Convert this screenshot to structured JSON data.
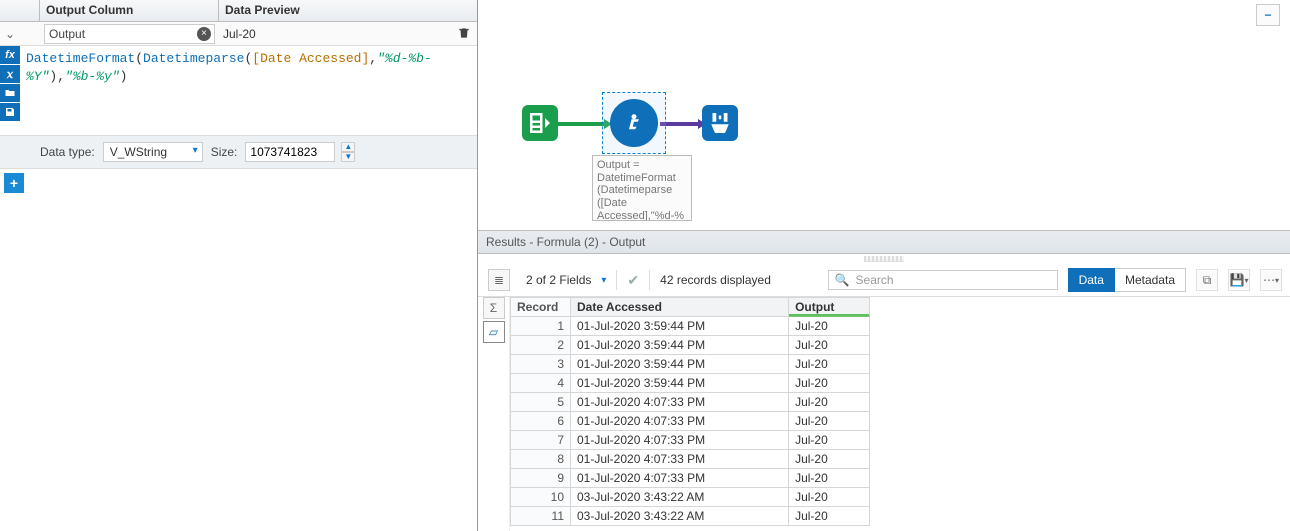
{
  "left": {
    "header_output_col": "Output Column",
    "header_preview": "Data Preview",
    "output_field_value": "Output",
    "preview_value": "Jul-20",
    "formula_fn": "DatetimeFormat",
    "formula_inner_fn": "Datetimeparse",
    "formula_bracket": "[Date Accessed]",
    "formula_lit1": "\"%d-%b-%Y\"",
    "formula_lit2": "\"%b-%y\"",
    "datatype_label": "Data type:",
    "datatype_value": "V_WString",
    "size_label": "Size:",
    "size_value": "1073741823"
  },
  "canvas": {
    "minus": "−",
    "anno_line1": "Output =",
    "anno_line2": "DatetimeFormat",
    "anno_line3": "(Datetimeparse",
    "anno_line4": "([Date",
    "anno_line5": "Accessed],\"%d-%"
  },
  "results": {
    "title": "Results - Formula (2) - Output",
    "fields_text": "2 of 2 Fields",
    "records_text": "42 records displayed",
    "search_placeholder": "Search",
    "data_label": "Data",
    "metadata_label": "Metadata",
    "columns": {
      "record": "Record",
      "date": "Date Accessed",
      "output": "Output"
    },
    "rows": [
      {
        "n": 1,
        "date": "01-Jul-2020 3:59:44 PM",
        "out": "Jul-20"
      },
      {
        "n": 2,
        "date": "01-Jul-2020 3:59:44 PM",
        "out": "Jul-20"
      },
      {
        "n": 3,
        "date": "01-Jul-2020 3:59:44 PM",
        "out": "Jul-20"
      },
      {
        "n": 4,
        "date": "01-Jul-2020 3:59:44 PM",
        "out": "Jul-20"
      },
      {
        "n": 5,
        "date": "01-Jul-2020 4:07:33 PM",
        "out": "Jul-20"
      },
      {
        "n": 6,
        "date": "01-Jul-2020 4:07:33 PM",
        "out": "Jul-20"
      },
      {
        "n": 7,
        "date": "01-Jul-2020 4:07:33 PM",
        "out": "Jul-20"
      },
      {
        "n": 8,
        "date": "01-Jul-2020 4:07:33 PM",
        "out": "Jul-20"
      },
      {
        "n": 9,
        "date": "01-Jul-2020 4:07:33 PM",
        "out": "Jul-20"
      },
      {
        "n": 10,
        "date": "03-Jul-2020 3:43:22 AM",
        "out": "Jul-20"
      },
      {
        "n": 11,
        "date": "03-Jul-2020 3:43:22 AM",
        "out": "Jul-20"
      }
    ]
  }
}
